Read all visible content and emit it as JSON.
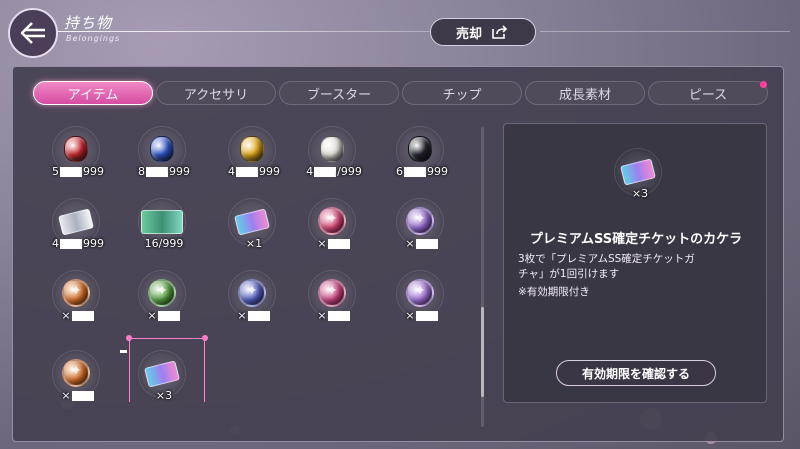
{
  "header": {
    "title": "持ち物",
    "subtitle": "Belongings",
    "sell_label": "売却",
    "back_icon": "arrow-left-icon",
    "sell_icon": "export-icon"
  },
  "tabs": [
    {
      "label": "アイテム",
      "active": true
    },
    {
      "label": "アクセサリ",
      "active": false
    },
    {
      "label": "ブースター",
      "active": false
    },
    {
      "label": "チップ",
      "active": false
    },
    {
      "label": "成長素材",
      "active": false
    },
    {
      "label": "ピース",
      "active": false
    }
  ],
  "items": [
    {
      "kind": "gem",
      "color": "#c8282e",
      "count_prefix": "5",
      "count_suffix": "999"
    },
    {
      "kind": "gem",
      "color": "#2f55c8",
      "count_prefix": "8",
      "count_suffix": "999"
    },
    {
      "kind": "gem",
      "color": "#e2a81c",
      "count_prefix": "4",
      "count_suffix": "999"
    },
    {
      "kind": "gem",
      "color": "#e4e0dc",
      "count_prefix": "4",
      "count_suffix": "/999"
    },
    {
      "kind": "gem",
      "color": "#22232c",
      "count_prefix": "6",
      "count_suffix": "999"
    },
    {
      "kind": "ticket-silver",
      "color": "#d9dbe3",
      "count_prefix": "4",
      "count_suffix": "999"
    },
    {
      "kind": "ticket-green",
      "color": "#3c8f74",
      "count_prefix": "",
      "count_suffix": "16/999"
    },
    {
      "kind": "ticket",
      "color": "#9d7ff0",
      "count_prefix": "",
      "count_suffix": "×1"
    },
    {
      "kind": "medal",
      "color": "#d0416f",
      "count_prefix": "×",
      "count_suffix": ""
    },
    {
      "kind": "medal",
      "color": "#8c62c7",
      "count_prefix": "×",
      "count_suffix": ""
    },
    {
      "kind": "medal",
      "color": "#cf6a22",
      "count_prefix": "×",
      "count_suffix": ""
    },
    {
      "kind": "medal",
      "color": "#4f9a3a",
      "count_prefix": "×",
      "count_suffix": ""
    },
    {
      "kind": "medal",
      "color": "#4c59b8",
      "count_prefix": "×",
      "count_suffix": ""
    },
    {
      "kind": "medal",
      "color": "#c8417c",
      "count_prefix": "×",
      "count_suffix": ""
    },
    {
      "kind": "medal",
      "color": "#9a6dd0",
      "count_prefix": "×",
      "count_suffix": ""
    },
    {
      "kind": "medal",
      "color": "#cf6a22",
      "count_prefix": "×",
      "count_suffix": ""
    },
    {
      "kind": "ticket",
      "color": "#9d7ff0",
      "count_prefix": "",
      "count_suffix": "×3"
    }
  ],
  "selected_index": 16,
  "detail": {
    "count": "×3",
    "name": "プレミアムSS確定チケットのカケラ",
    "desc_line1": "3枚で「プレミアムSS確定チケットガ",
    "desc_line2": "チャ」が1回引けます",
    "note": "※有効期限付き",
    "expiry_button": "有効期限を確認する"
  },
  "colors": {
    "accent": "#e0559f",
    "panel": "#444050"
  }
}
